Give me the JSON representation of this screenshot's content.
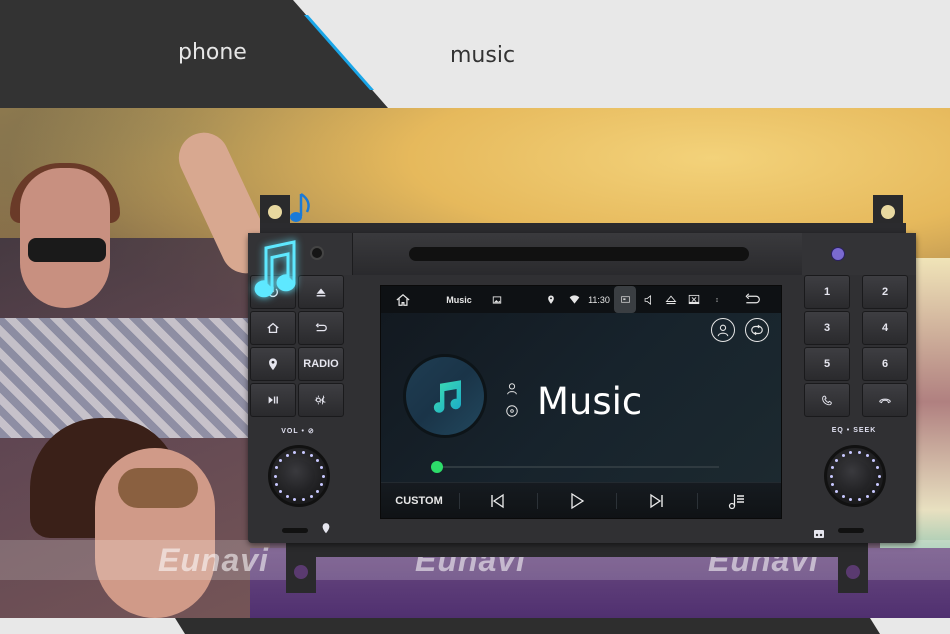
{
  "tabs": [
    {
      "label": "phone",
      "active": false
    },
    {
      "label": "music",
      "active": true
    }
  ],
  "colors": {
    "tab_dark": "#333333",
    "tab_light": "#e8e8e8",
    "tab_accent": "#1aa6e8",
    "progress": "#2ddc6a",
    "note_cyan": "#5ee8ff",
    "note_blue": "#1a7ad8",
    "indicator_purple": "#7a6ad0"
  },
  "watermark": {
    "text": "Eunavi"
  },
  "head_unit": {
    "left_buttons": [
      {
        "icon": "power-icon",
        "label": ""
      },
      {
        "icon": "eject-icon",
        "label": ""
      },
      {
        "icon": "home-icon",
        "label": ""
      },
      {
        "icon": "back-icon",
        "label": ""
      },
      {
        "icon": "navigation-pin-icon",
        "label": ""
      },
      {
        "icon": "",
        "label": "RADIO"
      },
      {
        "icon": "play-pause-icon",
        "label": ""
      },
      {
        "icon": "brightness-icon",
        "label": ""
      }
    ],
    "right_buttons": [
      {
        "label": "1"
      },
      {
        "label": "2"
      },
      {
        "label": "3"
      },
      {
        "label": "4"
      },
      {
        "label": "5"
      },
      {
        "label": "6"
      },
      {
        "icon": "call-answer-icon",
        "label": ""
      },
      {
        "icon": "call-end-icon",
        "label": ""
      }
    ],
    "left_knob_label": "VOL • ⊘",
    "right_knob_label": "EQ • SEEK"
  },
  "screen": {
    "statusbar": {
      "app_title": "Music",
      "time": "11:30",
      "icons": [
        "home-icon",
        "image-icon",
        "location-icon",
        "wifi-icon",
        "screen-mode-icon",
        "volume-icon",
        "eject-icon",
        "close-window-icon",
        "more-icon",
        "back-icon"
      ]
    },
    "track": {
      "title": "Music",
      "artist_icon": "person-icon",
      "album_icon": "disc-icon",
      "progress": 0.0
    },
    "controls": {
      "custom_label": "CUSTOM",
      "buttons": [
        "previous-icon",
        "play-icon",
        "next-icon",
        "playlist-icon"
      ]
    },
    "top_right_buttons": [
      "person-icon",
      "repeat-icon"
    ]
  }
}
